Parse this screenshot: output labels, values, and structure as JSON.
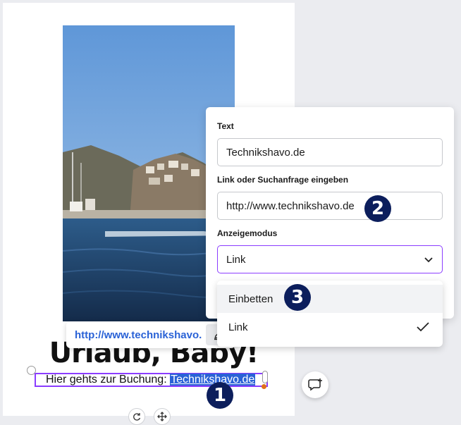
{
  "design": {
    "headline": "Urlaub, Baby!",
    "body_prefix": "Hier gehts zur Buchung: ",
    "link_text": "Technikshavo.de"
  },
  "link_chip": {
    "url": "http://www.technikshavo."
  },
  "link_panel": {
    "text_label": "Text",
    "text_value": "Technikshavo.de",
    "link_label": "Link oder Suchanfrage eingeben",
    "link_value": "http://www.technikshavo.de",
    "mode_label": "Anzeigemodus",
    "mode_selected": "Link"
  },
  "mode_options": [
    {
      "label": "Einbetten",
      "selected": false
    },
    {
      "label": "Link",
      "selected": true
    }
  ],
  "badges": [
    "1",
    "2",
    "3"
  ],
  "icons": {
    "chevron": "chevron-down-icon",
    "check": "check-icon",
    "edit": "pencil-icon",
    "comment": "add-comment-icon",
    "rotate": "rotate-icon",
    "move": "move-icon"
  },
  "colors": {
    "accent": "#8b3dff",
    "link": "#2a62d6",
    "badge": "#0c1e5c",
    "selection_dot": "#e0701a"
  }
}
